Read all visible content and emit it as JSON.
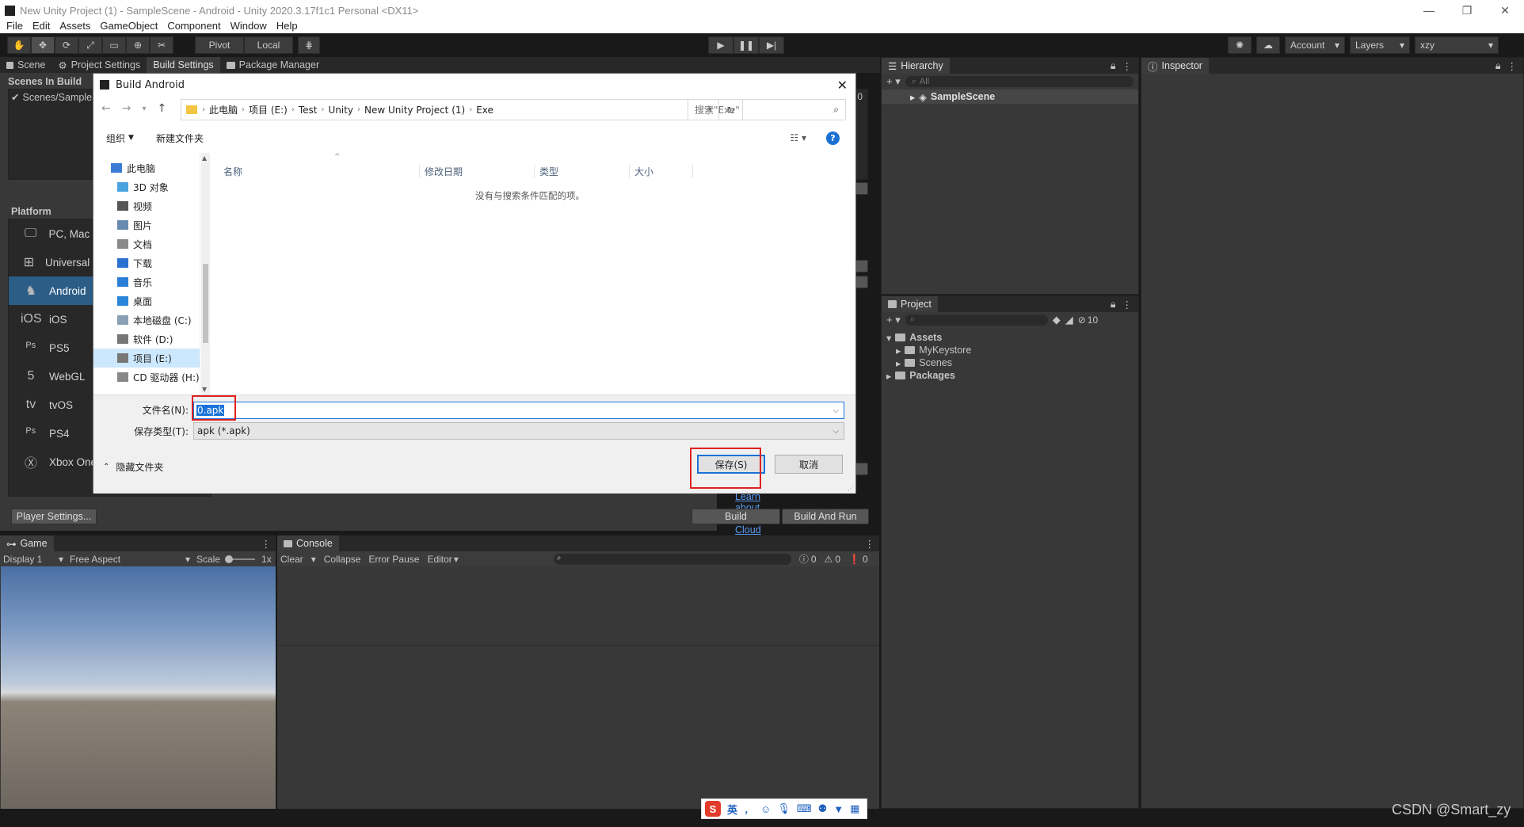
{
  "window": {
    "title": "New Unity Project (1) - SampleScene - Android - Unity 2020.3.17f1c1 Personal <DX11>",
    "controls": {
      "minimize": "—",
      "restore": "❐",
      "close": "✕"
    }
  },
  "menu": [
    "File",
    "Edit",
    "Assets",
    "GameObject",
    "Component",
    "Window",
    "Help"
  ],
  "toolbar": {
    "pivot": "Pivot",
    "local": "Local",
    "account": "Account",
    "layers": "Layers",
    "layout": "xzy"
  },
  "tabs_top": [
    "Scene",
    "Project Settings",
    "Build Settings",
    "Package Manager"
  ],
  "build_settings": {
    "scenes_header": "Scenes In Build",
    "scene_item": "Scenes/SampleS",
    "scene_index": "0",
    "platform_header": "Platform",
    "platforms": [
      {
        "label": "PC, Mac &",
        "icon": "monitor-icon"
      },
      {
        "label": "Universal V",
        "icon": "windows-icon"
      },
      {
        "label": "Android",
        "icon": "android-icon"
      },
      {
        "label": "iOS",
        "icon": "ios-icon"
      },
      {
        "label": "PS5",
        "icon": "ps5-icon"
      },
      {
        "label": "WebGL",
        "icon": "html5-icon"
      },
      {
        "label": "tvOS",
        "icon": "tvos-icon"
      },
      {
        "label": "PS4",
        "icon": "ps4-icon"
      },
      {
        "label": "Xbox One",
        "icon": "xbox-icon"
      }
    ],
    "selected_platform": "Android",
    "player_settings": "Player Settings...",
    "cloud_link": "Learn about Unity Cloud Build",
    "build": "Build",
    "build_and_run": "Build And Run"
  },
  "dialog": {
    "title": "Build Android",
    "breadcrumbs": [
      "此电脑",
      "项目 (E:)",
      "Test",
      "Unity",
      "New Unity Project (1)",
      "Exe"
    ],
    "search_placeholder": "搜索\"Exe\"",
    "organize": "组织",
    "new_folder": "新建文件夹",
    "help": "?",
    "columns": [
      "名称",
      "修改日期",
      "类型",
      "大小"
    ],
    "empty_message": "没有与搜索条件匹配的项。",
    "nav": [
      {
        "label": "此电脑",
        "icon": "pc-icon",
        "color": "#3a7bd5"
      },
      {
        "label": "3D 对象",
        "icon": "3d-objects-icon",
        "color": "#4aa3df"
      },
      {
        "label": "视频",
        "icon": "video-icon",
        "color": "#555555"
      },
      {
        "label": "图片",
        "icon": "pictures-icon",
        "color": "#6a8bb0"
      },
      {
        "label": "文档",
        "icon": "documents-icon",
        "color": "#8a8a8a"
      },
      {
        "label": "下载",
        "icon": "downloads-icon",
        "color": "#2b6fd1"
      },
      {
        "label": "音乐",
        "icon": "music-icon",
        "color": "#2b7fd6"
      },
      {
        "label": "桌面",
        "icon": "desktop-icon",
        "color": "#2b86d9"
      },
      {
        "label": "本地磁盘 (C:)",
        "icon": "drive-icon",
        "color": "#8aa0b5"
      },
      {
        "label": "软件 (D:)",
        "icon": "drive-icon",
        "color": "#777777"
      },
      {
        "label": "项目 (E:)",
        "icon": "drive-icon",
        "color": "#777777"
      },
      {
        "label": "CD 驱动器 (H:)",
        "icon": "cd-drive-icon",
        "color": "#888888"
      }
    ],
    "selected_nav": "项目 (E:)",
    "filename_label": "文件名(N):",
    "filename_value": "0.apk",
    "filetype_label": "保存类型(T):",
    "filetype_value": "apk (*.apk)",
    "hide_folders": "隐藏文件夹",
    "save": "保存(S)",
    "cancel": "取消"
  },
  "hierarchy": {
    "tab": "Hierarchy",
    "search_placeholder": "All",
    "scene": "SampleScene"
  },
  "inspector": {
    "tab": "Inspector"
  },
  "project": {
    "tab": "Project",
    "hidden_count": "10",
    "tree": [
      {
        "label": "Assets",
        "level": 0,
        "bold": true
      },
      {
        "label": "MyKeystore",
        "level": 1,
        "bold": false
      },
      {
        "label": "Scenes",
        "level": 1,
        "bold": false
      },
      {
        "label": "Packages",
        "level": 0,
        "bold": true
      }
    ]
  },
  "game": {
    "tab": "Game",
    "display": "Display 1",
    "aspect": "Free Aspect",
    "scale_label": "Scale",
    "scale_value": "1x"
  },
  "console": {
    "tab": "Console",
    "clear": "Clear",
    "collapse": "Collapse",
    "error_pause": "Error Pause",
    "editor": "Editor",
    "log_count": "0",
    "warn_count": "0",
    "error_count": "0"
  },
  "ime": {
    "lang": "英",
    "punct": "，"
  },
  "watermark": "CSDN @Smart_zy"
}
